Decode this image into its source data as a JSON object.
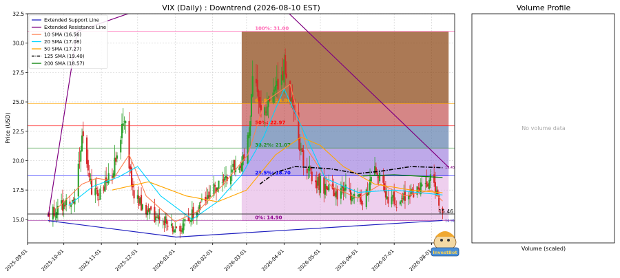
{
  "chart_data": [
    {
      "type": "candlestick",
      "title": "VIX (Daily) : Downtrend (2026-08-10 EST)",
      "xlabel": "",
      "ylabel": "Price (USD)",
      "ylim": [
        13.0,
        32.5
      ],
      "xlim": [
        "2025-09-01",
        "2026-08-20"
      ],
      "grid": true,
      "legend_position": "top-left",
      "y_ticks": [
        "15.0",
        "17.5",
        "20.0",
        "22.5",
        "25.0",
        "27.5",
        "30.0",
        "32.5"
      ],
      "x_ticks": [
        "2025-09-01",
        "2025-10-01",
        "2025-11-01",
        "2025-12-01",
        "2026-01-01",
        "2026-02-01",
        "2026-03-01",
        "2026-04-01",
        "2026-05-01",
        "2026-06-01",
        "2026-07-01",
        "2026-08-01"
      ],
      "colors": {
        "up": "#2ca02c",
        "down": "#d62728",
        "support": "#1f1fbf",
        "resistance": "#800080"
      },
      "legend": [
        {
          "label": "Extended Support Line",
          "color": "#1f1fbf",
          "dash": "solid"
        },
        {
          "label": "Extended Resistance Line",
          "color": "#800080",
          "dash": "solid"
        },
        {
          "label": "10 SMA (16.56)",
          "color": "#ff7f50",
          "dash": "solid"
        },
        {
          "label": "20 SMA (17.08)",
          "color": "#00d5ff",
          "dash": "solid"
        },
        {
          "label": "50 SMA (17.27)",
          "color": "#ffa500",
          "dash": "solid"
        },
        {
          "label": "125 SMA (19.40)",
          "color": "#000000",
          "dash": "dashdot"
        },
        {
          "label": "200 SMA (18.57)",
          "color": "#008000",
          "dash": "solid"
        }
      ],
      "candle_anchors": [
        [
          "2025-09-18",
          15.3
        ],
        [
          "2025-10-01",
          16.2
        ],
        [
          "2025-10-10",
          17.0
        ],
        [
          "2025-10-16",
          22.5
        ],
        [
          "2025-10-22",
          18.0
        ],
        [
          "2025-10-31",
          17.0
        ],
        [
          "2025-11-07",
          18.5
        ],
        [
          "2025-11-14",
          20.0
        ],
        [
          "2025-11-20",
          24.0
        ],
        [
          "2025-11-26",
          17.5
        ],
        [
          "2025-12-05",
          16.0
        ],
        [
          "2025-12-12",
          15.5
        ],
        [
          "2025-12-22",
          15.0
        ],
        [
          "2026-01-02",
          14.2
        ],
        [
          "2026-01-12",
          15.0
        ],
        [
          "2026-01-22",
          16.2
        ],
        [
          "2026-02-02",
          17.5
        ],
        [
          "2026-02-11",
          18.5
        ],
        [
          "2026-02-20",
          19.5
        ],
        [
          "2026-02-27",
          20.5
        ],
        [
          "2026-03-03",
          22.5
        ],
        [
          "2026-03-06",
          27.5
        ],
        [
          "2026-03-12",
          25.0
        ],
        [
          "2026-03-20",
          24.5
        ],
        [
          "2026-03-27",
          27.0
        ],
        [
          "2026-04-02",
          28.0
        ],
        [
          "2026-04-08",
          24.5
        ],
        [
          "2026-04-14",
          21.0
        ],
        [
          "2026-04-22",
          19.0
        ],
        [
          "2026-05-01",
          18.0
        ],
        [
          "2026-05-12",
          17.0
        ],
        [
          "2026-05-22",
          17.5
        ],
        [
          "2026-06-01",
          16.5
        ],
        [
          "2026-06-08",
          17.0
        ],
        [
          "2026-06-16",
          19.5
        ],
        [
          "2026-06-25",
          17.0
        ],
        [
          "2026-07-03",
          16.5
        ],
        [
          "2026-07-14",
          17.3
        ],
        [
          "2026-07-24",
          17.5
        ],
        [
          "2026-07-30",
          18.5
        ],
        [
          "2026-08-05",
          17.5
        ],
        [
          "2026-08-10",
          15.5
        ]
      ],
      "sma": {
        "sma10": [
          [
            "2025-09-25",
            15.9
          ],
          [
            "2025-10-16",
            18.0
          ],
          [
            "2025-10-28",
            18.5
          ],
          [
            "2025-11-10",
            18.3
          ],
          [
            "2025-11-24",
            20.5
          ],
          [
            "2025-12-08",
            17.0
          ],
          [
            "2026-01-01",
            14.8
          ],
          [
            "2026-01-20",
            15.7
          ],
          [
            "2026-02-10",
            18.0
          ],
          [
            "2026-03-02",
            20.5
          ],
          [
            "2026-03-16",
            25.0
          ],
          [
            "2026-04-06",
            26.5
          ],
          [
            "2026-04-20",
            21.0
          ],
          [
            "2026-05-10",
            17.8
          ],
          [
            "2026-06-01",
            16.8
          ],
          [
            "2026-06-20",
            18.0
          ],
          [
            "2026-07-10",
            17.0
          ],
          [
            "2026-08-01",
            17.5
          ],
          [
            "2026-08-10",
            16.56
          ]
        ],
        "sma20": [
          [
            "2025-10-05",
            16.2
          ],
          [
            "2025-10-25",
            17.8
          ],
          [
            "2025-11-15",
            18.6
          ],
          [
            "2025-12-01",
            19.5
          ],
          [
            "2025-12-20",
            17.0
          ],
          [
            "2026-01-15",
            15.0
          ],
          [
            "2026-02-05",
            16.5
          ],
          [
            "2026-02-25",
            18.8
          ],
          [
            "2026-03-15",
            22.0
          ],
          [
            "2026-04-01",
            26.1
          ],
          [
            "2026-04-15",
            23.0
          ],
          [
            "2026-05-05",
            18.5
          ],
          [
            "2026-06-01",
            17.3
          ],
          [
            "2026-07-01",
            17.5
          ],
          [
            "2026-08-10",
            17.08
          ]
        ],
        "sma50": [
          [
            "2025-11-10",
            17.5
          ],
          [
            "2025-12-10",
            18.2
          ],
          [
            "2026-01-10",
            17.0
          ],
          [
            "2026-02-05",
            16.5
          ],
          [
            "2026-03-01",
            17.5
          ],
          [
            "2026-03-25",
            20.5
          ],
          [
            "2026-04-15",
            22.0
          ],
          [
            "2026-05-01",
            21.3
          ],
          [
            "2026-05-20",
            19.5
          ],
          [
            "2026-06-15",
            18.0
          ],
          [
            "2026-07-15",
            17.5
          ],
          [
            "2026-08-10",
            17.27
          ]
        ],
        "sma125": [
          [
            "2026-03-12",
            18.0
          ],
          [
            "2026-03-25",
            19.0
          ],
          [
            "2026-04-10",
            19.5
          ],
          [
            "2026-05-10",
            19.3
          ],
          [
            "2026-06-01",
            18.9
          ],
          [
            "2026-06-20",
            19.1
          ],
          [
            "2026-07-15",
            19.5
          ],
          [
            "2026-08-10",
            19.4
          ]
        ],
        "sma200": [
          [
            "2026-06-05",
            18.7
          ],
          [
            "2026-07-01",
            18.8
          ],
          [
            "2026-08-10",
            18.57
          ]
        ]
      },
      "support_line": [
        [
          "2025-09-18",
          14.9
        ],
        [
          "2026-01-02",
          13.5
        ],
        [
          "2026-08-10",
          14.91
        ]
      ],
      "resistance_line": [
        [
          "2025-09-18",
          15.2
        ],
        [
          "2025-10-12",
          31.0
        ],
        [
          "2026-03-01",
          36.0
        ],
        [
          "2026-08-15",
          19.45
        ]
      ],
      "line_end_labels": [
        {
          "text": "19.45",
          "date": "2026-08-12",
          "value": 19.45,
          "color": "#800080"
        },
        {
          "text": "14.91",
          "date": "2026-08-12",
          "value": 14.91,
          "color": "#1f1fbf"
        }
      ],
      "price_line": {
        "value": 15.46,
        "label": "15.46"
      },
      "fibonacci": {
        "start": "2026-02-25",
        "end": "2026-08-15",
        "levels": [
          {
            "label": "100%: 31.00",
            "value": 31.0,
            "color": "#ff69b4"
          },
          {
            "label": "61.8%: 24.86",
            "value": 24.86,
            "color": "#ffa500"
          },
          {
            "label": "50%: 22.97",
            "value": 22.97,
            "color": "#ff0000"
          },
          {
            "label": "38.2%: 21.07",
            "value": 21.07,
            "color": "#228b22"
          },
          {
            "label": "23.5%: 18.70",
            "value": 18.7,
            "color": "#0000ff"
          },
          {
            "label": "0%: 14.90",
            "value": 14.9,
            "color": "#8b008b"
          }
        ],
        "bands": [
          {
            "from": 24.86,
            "to": 31.0,
            "color": "#8b4513",
            "opacity": 0.72
          },
          {
            "from": 22.97,
            "to": 24.86,
            "color": "#b22222",
            "opacity": 0.55
          },
          {
            "from": 21.07,
            "to": 22.97,
            "color": "#5f7fae",
            "opacity": 0.7
          },
          {
            "from": 18.7,
            "to": 21.07,
            "color": "#9370db",
            "opacity": 0.6
          },
          {
            "from": 14.9,
            "to": 18.7,
            "color": "#dda0dd",
            "opacity": 0.5
          }
        ]
      }
    },
    {
      "type": "bar",
      "title": "Volume Profile",
      "xlabel": "Volume (scaled)",
      "ylabel": "",
      "message": "No volume data"
    }
  ],
  "watermark": {
    "text": "InvestBot",
    "accent": "#f0a830"
  }
}
